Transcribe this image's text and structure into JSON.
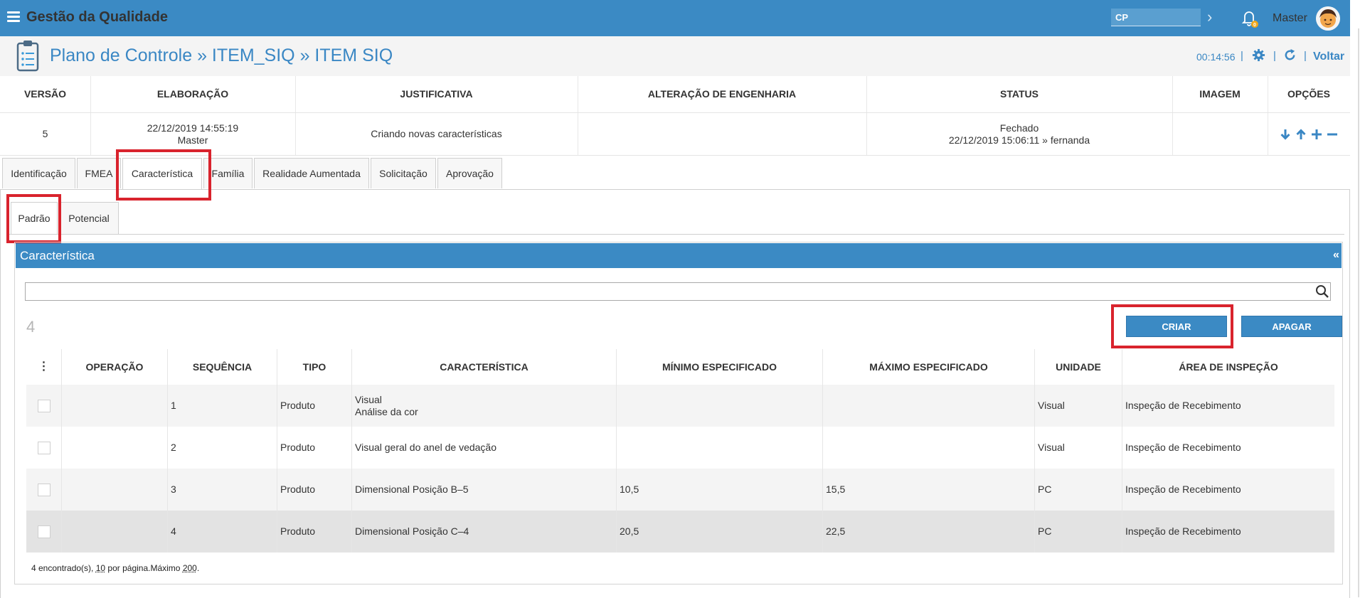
{
  "app": {
    "title": "Gestão da Qualidade"
  },
  "topbar": {
    "cp_value": "CP",
    "user_name": "Master"
  },
  "header": {
    "title": "Plano de Controle » ITEM_SIQ » ITEM SIQ",
    "timer": "00:14:56",
    "separator": "|",
    "back_label": "Voltar"
  },
  "version_table": {
    "headers": [
      "VERSÃO",
      "ELABORAÇÃO",
      "JUSTIFICATIVA",
      "ALTERAÇÃO DE ENGENHARIA",
      "STATUS",
      "IMAGEM",
      "OPÇÕES"
    ],
    "row": {
      "version": "5",
      "elaboration_date": "22/12/2019 14:55:19",
      "elaboration_user": "Master",
      "justification": "Criando novas características",
      "engineering_change": "",
      "status": "Fechado",
      "status_detail": "22/12/2019 15:06:11 » fernanda",
      "image": ""
    }
  },
  "tabs": [
    "Identificação",
    "FMEA",
    "Característica",
    "Família",
    "Realidade Aumentada",
    "Solicitação",
    "Aprovação"
  ],
  "active_tab": "Característica",
  "subtabs": [
    "Padrão",
    "Potencial"
  ],
  "active_subtab": "Padrão",
  "panel": {
    "title": "Característica",
    "collapse": "«",
    "search_value": "",
    "count": "4",
    "create_label": "CRIAR",
    "delete_label": "APAGAR"
  },
  "table": {
    "menu_glyph": "⋮",
    "headers": [
      "OPERAÇÃO",
      "SEQUÊNCIA",
      "TIPO",
      "CARACTERÍSTICA",
      "MÍNIMO ESPECIFICADO",
      "MÁXIMO ESPECIFICADO",
      "UNIDADE",
      "ÁREA DE INSPEÇÃO"
    ],
    "rows": [
      {
        "operation": "",
        "sequence": "1",
        "type": "Produto",
        "characteristic": "Visual",
        "characteristic_detail": "Análise da cor",
        "min": "",
        "max": "",
        "unit": "Visual",
        "area": "Inspeção de Recebimento"
      },
      {
        "operation": "",
        "sequence": "2",
        "type": "Produto",
        "characteristic": "Visual geral do anel de vedação",
        "characteristic_detail": "",
        "min": "",
        "max": "",
        "unit": "Visual",
        "area": "Inspeção de Recebimento"
      },
      {
        "operation": "",
        "sequence": "3",
        "type": "Produto",
        "characteristic": "Dimensional Posição B–5",
        "characteristic_detail": "",
        "min": "10,5",
        "max": "15,5",
        "unit": "PC",
        "area": "Inspeção de Recebimento"
      },
      {
        "operation": "",
        "sequence": "4",
        "type": "Produto",
        "characteristic": "Dimensional Posição C–4",
        "characteristic_detail": "",
        "min": "20,5",
        "max": "22,5",
        "unit": "PC",
        "area": "Inspeção de Recebimento"
      }
    ],
    "footer": {
      "found": "4 encontrado(s), ",
      "per_page": "10",
      "per_page_suffix": " por página.Máximo ",
      "max": "200",
      "end": "."
    }
  },
  "colors": {
    "primary": "#3b8ac4",
    "highlight": "#d9232d",
    "row_alt": "#f4f4f4",
    "row_selected": "#e3e3e3"
  },
  "icons": [
    "menu-icon",
    "chevron-right-icon",
    "bell-icon",
    "avatar",
    "clipboard-icon",
    "gear-icon",
    "refresh-icon",
    "arrow-down-icon",
    "arrow-up-icon",
    "plus-icon",
    "minus-icon",
    "search-icon"
  ]
}
